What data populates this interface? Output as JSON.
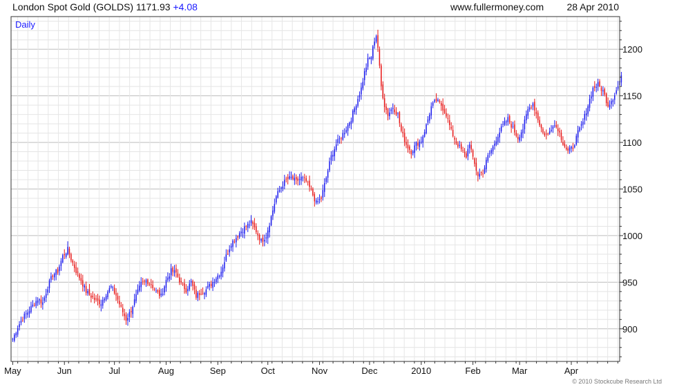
{
  "header": {
    "title": "London Spot Gold (GOLDS)",
    "last": "1171.93",
    "change": "+4.08",
    "site": "www.fullermoney.com",
    "date": "28 Apr 2010"
  },
  "colors": {
    "up": "#1a1aee",
    "down": "#e81818",
    "grid": "#d4d4d4",
    "axis": "#333333"
  },
  "chart_data": {
    "type": "candlestick",
    "title": "London Spot Gold (GOLDS) 1171.93 +4.08",
    "period": "Daily",
    "xlabel": "",
    "ylabel": "",
    "ylim": [
      865,
      1235
    ],
    "y_ticks": [
      900,
      950,
      1000,
      1050,
      1100,
      1150,
      1200
    ],
    "x_tick_labels": [
      "May",
      "Jun",
      "Jul",
      "Aug",
      "Sep",
      "Oct",
      "Nov",
      "Dec",
      "2010",
      "Feb",
      "Mar",
      "Apr"
    ],
    "x_tick_days": [
      1,
      32,
      62,
      93,
      124,
      154,
      185,
      215,
      246,
      277,
      305,
      336
    ],
    "xlim_days": [
      0,
      365
    ],
    "y_axis_position": "right",
    "grid": true,
    "closes": [
      [
        1,
        889
      ],
      [
        4,
        902
      ],
      [
        7,
        912
      ],
      [
        10,
        918
      ],
      [
        13,
        925
      ],
      [
        16,
        932
      ],
      [
        19,
        928
      ],
      [
        22,
        945
      ],
      [
        25,
        958
      ],
      [
        28,
        962
      ],
      [
        31,
        978
      ],
      [
        34,
        985
      ],
      [
        36,
        975
      ],
      [
        39,
        962
      ],
      [
        42,
        952
      ],
      [
        45,
        940
      ],
      [
        48,
        935
      ],
      [
        51,
        930
      ],
      [
        54,
        928
      ],
      [
        57,
        938
      ],
      [
        60,
        945
      ],
      [
        63,
        936
      ],
      [
        66,
        922
      ],
      [
        69,
        910
      ],
      [
        72,
        920
      ],
      [
        75,
        935
      ],
      [
        78,
        948
      ],
      [
        81,
        952
      ],
      [
        84,
        948
      ],
      [
        87,
        940
      ],
      [
        90,
        935
      ],
      [
        93,
        952
      ],
      [
        96,
        962
      ],
      [
        99,
        960
      ],
      [
        102,
        948
      ],
      [
        105,
        942
      ],
      [
        108,
        950
      ],
      [
        111,
        935
      ],
      [
        114,
        940
      ],
      [
        117,
        942
      ],
      [
        120,
        948
      ],
      [
        123,
        955
      ],
      [
        126,
        962
      ],
      [
        129,
        978
      ],
      [
        132,
        992
      ],
      [
        135,
        998
      ],
      [
        138,
        1005
      ],
      [
        141,
        1010
      ],
      [
        144,
        1014
      ],
      [
        147,
        1005
      ],
      [
        150,
        994
      ],
      [
        153,
        1000
      ],
      [
        156,
        1020
      ],
      [
        159,
        1042
      ],
      [
        162,
        1052
      ],
      [
        165,
        1060
      ],
      [
        168,
        1062
      ],
      [
        171,
        1058
      ],
      [
        174,
        1062
      ],
      [
        177,
        1058
      ],
      [
        180,
        1048
      ],
      [
        183,
        1035
      ],
      [
        186,
        1040
      ],
      [
        189,
        1062
      ],
      [
        192,
        1085
      ],
      [
        195,
        1098
      ],
      [
        198,
        1106
      ],
      [
        201,
        1115
      ],
      [
        204,
        1126
      ],
      [
        207,
        1142
      ],
      [
        210,
        1158
      ],
      [
        212,
        1175
      ],
      [
        214,
        1188
      ],
      [
        216,
        1192
      ],
      [
        218,
        1210
      ],
      [
        219,
        1215
      ],
      [
        220,
        1202
      ],
      [
        221,
        1180
      ],
      [
        222,
        1160
      ],
      [
        224,
        1140
      ],
      [
        226,
        1130
      ],
      [
        229,
        1138
      ],
      [
        232,
        1130
      ],
      [
        234,
        1112
      ],
      [
        237,
        1098
      ],
      [
        240,
        1090
      ],
      [
        243,
        1098
      ],
      [
        246,
        1102
      ],
      [
        249,
        1118
      ],
      [
        252,
        1138
      ],
      [
        255,
        1145
      ],
      [
        258,
        1140
      ],
      [
        261,
        1130
      ],
      [
        264,
        1112
      ],
      [
        267,
        1100
      ],
      [
        270,
        1092
      ],
      [
        273,
        1085
      ],
      [
        275,
        1100
      ],
      [
        277,
        1082
      ],
      [
        280,
        1065
      ],
      [
        283,
        1068
      ],
      [
        286,
        1085
      ],
      [
        289,
        1095
      ],
      [
        292,
        1108
      ],
      [
        295,
        1118
      ],
      [
        298,
        1125
      ],
      [
        301,
        1115
      ],
      [
        304,
        1105
      ],
      [
        307,
        1115
      ],
      [
        310,
        1135
      ],
      [
        313,
        1142
      ],
      [
        316,
        1125
      ],
      [
        319,
        1110
      ],
      [
        322,
        1108
      ],
      [
        325,
        1120
      ],
      [
        328,
        1115
      ],
      [
        331,
        1100
      ],
      [
        334,
        1090
      ],
      [
        337,
        1095
      ],
      [
        340,
        1110
      ],
      [
        343,
        1122
      ],
      [
        346,
        1140
      ],
      [
        349,
        1158
      ],
      [
        352,
        1162
      ],
      [
        355,
        1155
      ],
      [
        358,
        1140
      ],
      [
        361,
        1148
      ],
      [
        364,
        1160
      ],
      [
        366,
        1172
      ]
    ]
  },
  "copyright": "© 2010 Stockcube Research Ltd"
}
